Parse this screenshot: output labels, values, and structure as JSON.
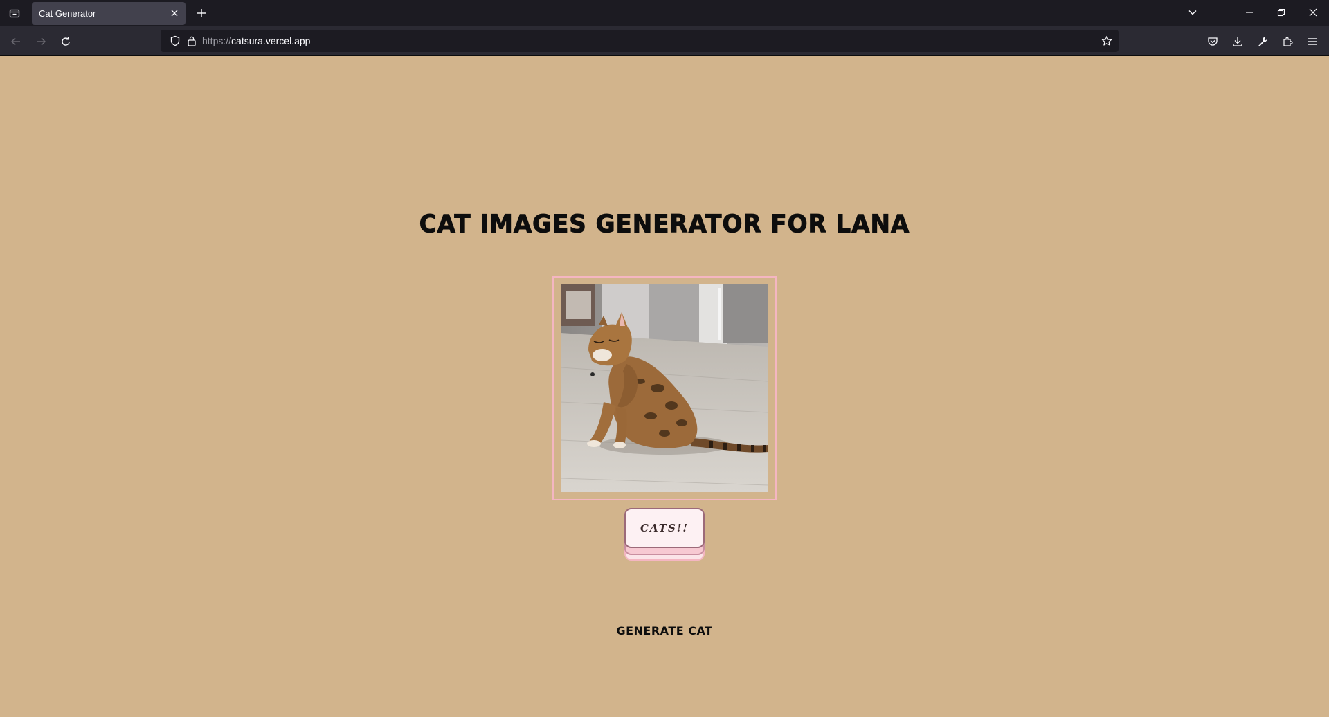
{
  "browser": {
    "tab": {
      "title": "Cat Generator"
    },
    "url": {
      "scheme": "https://",
      "host": "catsura.vercel.app"
    },
    "icons": {
      "tab_list": "tab-list-icon",
      "tab_close": "close-icon",
      "new_tab": "plus-icon",
      "list_all_tabs": "chevron-down-icon",
      "minimize": "minimize-icon",
      "restore": "restore-icon",
      "close_window": "close-icon",
      "back": "arrow-left-icon",
      "forward": "arrow-right-icon",
      "reload": "reload-icon",
      "tracking_protection": "shield-icon",
      "site_security": "lock-icon",
      "bookmark": "star-icon",
      "pocket": "pocket-icon",
      "downloads": "download-icon",
      "tools": "wrench-icon",
      "extensions": "puzzle-icon",
      "menu": "hamburger-icon"
    }
  },
  "page": {
    "title": "Cat Images Generator for Lana",
    "image": {
      "alt": "Bengal cat scratching its chin on a wooden floor in a kitchen"
    },
    "button": {
      "label": "CATS!!"
    },
    "caption": "Generate Cat"
  },
  "colors": {
    "page_background": "#d2b48c",
    "frame_border": "#f4b6c2",
    "button_face": "#fdf1f3",
    "button_layer": "#f7c9d2"
  }
}
